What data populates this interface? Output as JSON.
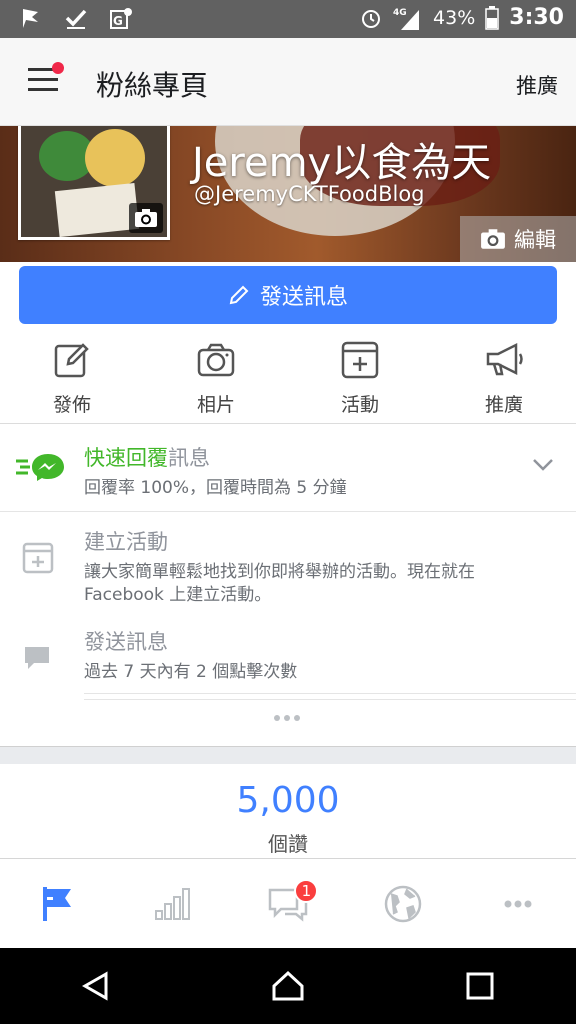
{
  "status_bar": {
    "battery": "43%",
    "time": "3:30",
    "network": "4G"
  },
  "app_bar": {
    "title": "粉絲專頁",
    "action": "推廣"
  },
  "cover": {
    "page_name": "Jeremy以食為天",
    "handle": "@JeremyCKTFoodBlog",
    "edit_label": "編輯",
    "card_text": "Jeremy以食為天"
  },
  "message_button": {
    "label": "發送訊息"
  },
  "actions": [
    {
      "label": "發佈",
      "icon": "compose-icon"
    },
    {
      "label": "相片",
      "icon": "camera-icon"
    },
    {
      "label": "活動",
      "icon": "event-icon"
    },
    {
      "label": "推廣",
      "icon": "megaphone-icon"
    }
  ],
  "list": {
    "quick_reply": {
      "title_green": "快速回覆",
      "title_gray": "訊息",
      "subtitle": "回覆率 100%，回覆時間為 5 分鐘"
    },
    "create_event": {
      "title": "建立活動",
      "subtitle": "讓大家簡單輕鬆地找到你即將舉辦的活動。現在就在 Facebook 上建立活動。"
    },
    "send_message": {
      "title": "發送訊息",
      "subtitle": "過去 7 天內有 2 個點擊次數"
    }
  },
  "likes": {
    "count": "5,000",
    "label": "個讚"
  },
  "tabs": [
    {
      "name": "page",
      "active": true
    },
    {
      "name": "insights"
    },
    {
      "name": "messages",
      "badge": "1"
    },
    {
      "name": "notifications"
    },
    {
      "name": "more"
    }
  ],
  "colors": {
    "accent": "#4080ff",
    "green": "#42b72a",
    "badge": "#fa3e3e"
  }
}
